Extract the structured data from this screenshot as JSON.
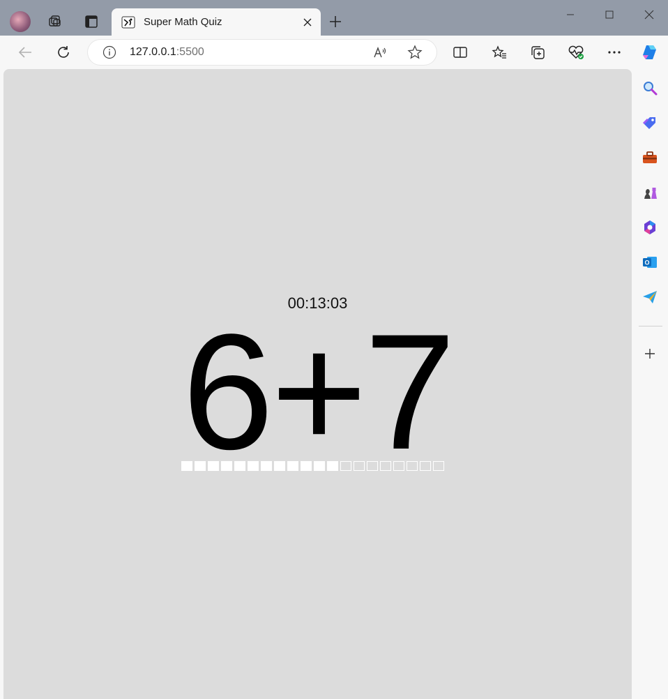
{
  "browser": {
    "tab": {
      "title": "Super Math Quiz"
    },
    "address": {
      "host": "127.0.0.1",
      "port": ":5500"
    }
  },
  "quiz": {
    "timer": "00:13:03",
    "problem": "6+7",
    "progress": {
      "total": 20,
      "completed": 12
    }
  },
  "icons": {
    "sidebar": [
      "search-icon",
      "shopping-tag-icon",
      "toolbox-icon",
      "chess-icon",
      "microsoft365-icon",
      "outlook-icon",
      "send-icon",
      "add-icon"
    ]
  },
  "colors": {
    "page_bg": "#dcdcdc",
    "chrome_bg": "#f7f7f7",
    "titlebar_bg": "#939ba8",
    "text": "#000000",
    "progress_cell": "#ffffff"
  }
}
